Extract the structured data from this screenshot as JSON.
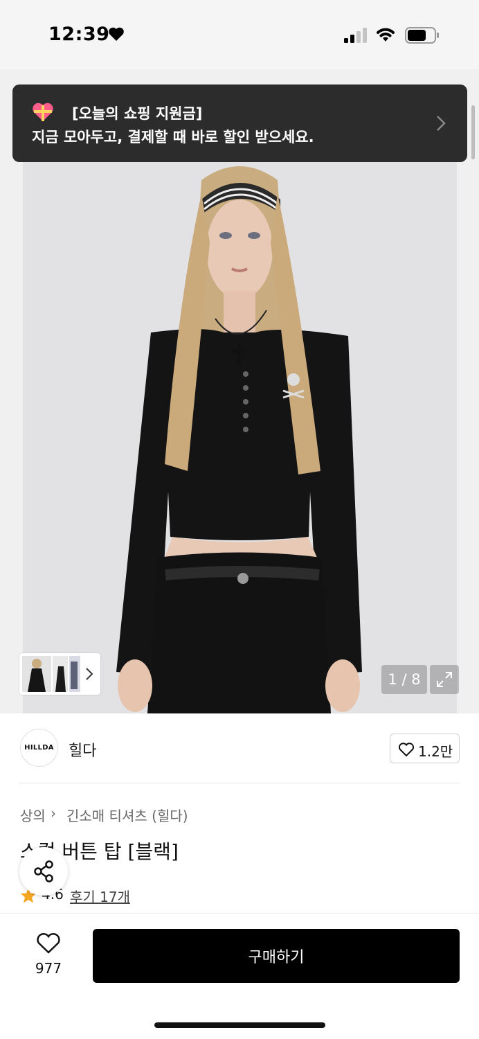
{
  "status_bar": {
    "time": "12:39"
  },
  "banner": {
    "title": "[오늘의 쇼핑 지원금]",
    "subtitle": "지금 모아두고, 결제할 때 바로 할인 받으세요."
  },
  "gallery": {
    "counter": "1 / 8"
  },
  "brand": {
    "logo_text": "HILLDA",
    "name": "힐다",
    "likes": "1.2만"
  },
  "breadcrumb": {
    "category": "상의",
    "separator": "›",
    "subcategory": "긴소매 티셔츠 (힐다)"
  },
  "product": {
    "title": "스컬 버튼 탑 [블랙]",
    "rating": "4.6",
    "reviews": "후기 17개"
  },
  "bottom_bar": {
    "wish_count": "977",
    "buy_label": "구매하기"
  },
  "colors": {
    "banner_bg": "#2c2c2c",
    "star": "#f5a623",
    "buy_bg": "#000000"
  }
}
